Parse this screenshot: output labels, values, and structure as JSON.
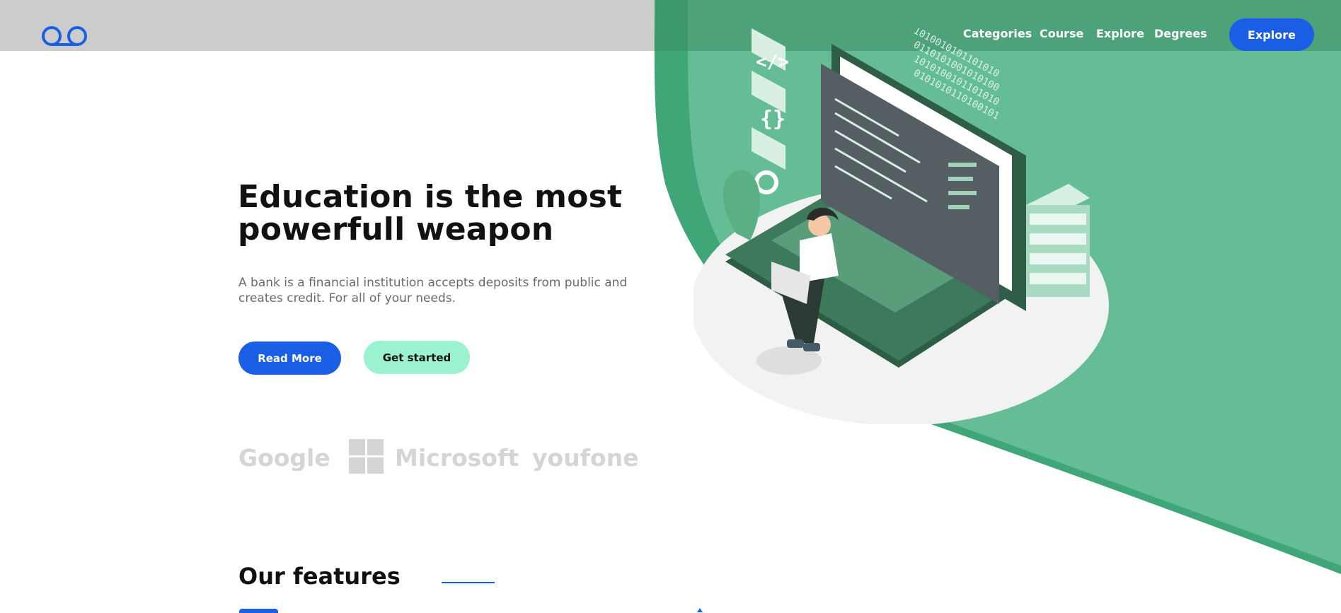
{
  "header": {
    "logo_icon": "infinity-loop-logo",
    "nav": [
      "Categories",
      "Course",
      "Explore",
      "Degrees"
    ],
    "cta_label": "Explore"
  },
  "hero": {
    "title": "Education is the most powerfull weapon",
    "subtitle": "A bank is a financial institution accepts deposits from public and creates credit. For all of your needs.",
    "primary_button": "Read More",
    "secondary_button": "Get started",
    "illustration": "woman-with-laptop-coding-illustration"
  },
  "brands": [
    "Google",
    "Microsoft",
    "youfone"
  ],
  "features": {
    "title": "Our features"
  },
  "colors": {
    "accent_blue": "#1a5ee6",
    "mint": "#9af2cf",
    "green": "#62bd92",
    "dark_green": "#3d9d70",
    "nav_gray": "#cccccc"
  }
}
